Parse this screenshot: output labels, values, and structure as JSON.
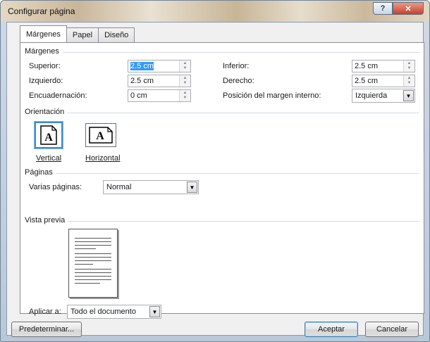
{
  "window": {
    "title": "Configurar página"
  },
  "titlebar": {
    "help_glyph": "?",
    "close_glyph": "✕"
  },
  "tabs": [
    {
      "label": "Márgenes",
      "active": true
    },
    {
      "label": "Papel",
      "active": false
    },
    {
      "label": "Diseño",
      "active": false
    }
  ],
  "margins": {
    "section_label": "Márgenes",
    "superior": {
      "label": "Superior:",
      "value": "2.5 cm"
    },
    "izquierdo": {
      "label": "Izquierdo:",
      "value": "2.5 cm"
    },
    "encuadernacion": {
      "label": "Encuadernación:",
      "value": "0 cm"
    },
    "inferior": {
      "label": "Inferior:",
      "value": "2.5 cm"
    },
    "derecho": {
      "label": "Derecho:",
      "value": "2.5 cm"
    },
    "posicion": {
      "label": "Posición del margen interno:",
      "value": "Izquierda"
    }
  },
  "orientation": {
    "section_label": "Orientación",
    "vertical_label": "Vertical",
    "horizontal_label": "Horizontal",
    "icon_glyph": "A"
  },
  "pages": {
    "section_label": "Páginas",
    "varias_label": "Varias páginas:",
    "varias_value": "Normal"
  },
  "preview": {
    "section_label": "Vista previa"
  },
  "apply": {
    "label": "Aplicar a:",
    "value": "Todo el documento"
  },
  "buttons": {
    "default": "Predeterminar...",
    "ok": "Aceptar",
    "cancel": "Cancelar"
  },
  "colors": {
    "selection": "#3399ff",
    "accent_border": "#3a8ad8"
  }
}
